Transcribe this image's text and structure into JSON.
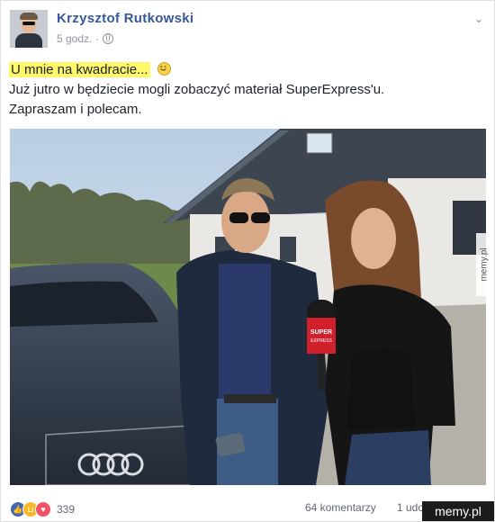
{
  "post": {
    "author": "Krzysztof Rutkowski",
    "time": "5 godz.",
    "separator": "·",
    "text_line1_highlight": "U mnie na kwadracie...",
    "text_line2": "Już jutro w będziecie mogli zobaczyć materiał SuperExpress'u.",
    "text_line3": "Zapraszam i polecam.",
    "mic_label_1": "SUPER",
    "mic_label_2": "EXPRESS"
  },
  "footer": {
    "reaction_count": "339",
    "comments": "64 komentarzy",
    "shares": "1 udostępnienie"
  },
  "watermark": {
    "side": "memy.pl",
    "corner": "memy.pl"
  },
  "icons": {
    "globe": "globe-icon",
    "menu": "chevron-down-icon",
    "reactions": [
      "like-icon",
      "haha-icon",
      "love-icon"
    ],
    "emoji": "smiley-icon"
  },
  "colors": {
    "author": "#365899",
    "highlight": "#fff86b",
    "like": "#4267b2",
    "haha": "#f7b928",
    "love": "#f25268"
  }
}
